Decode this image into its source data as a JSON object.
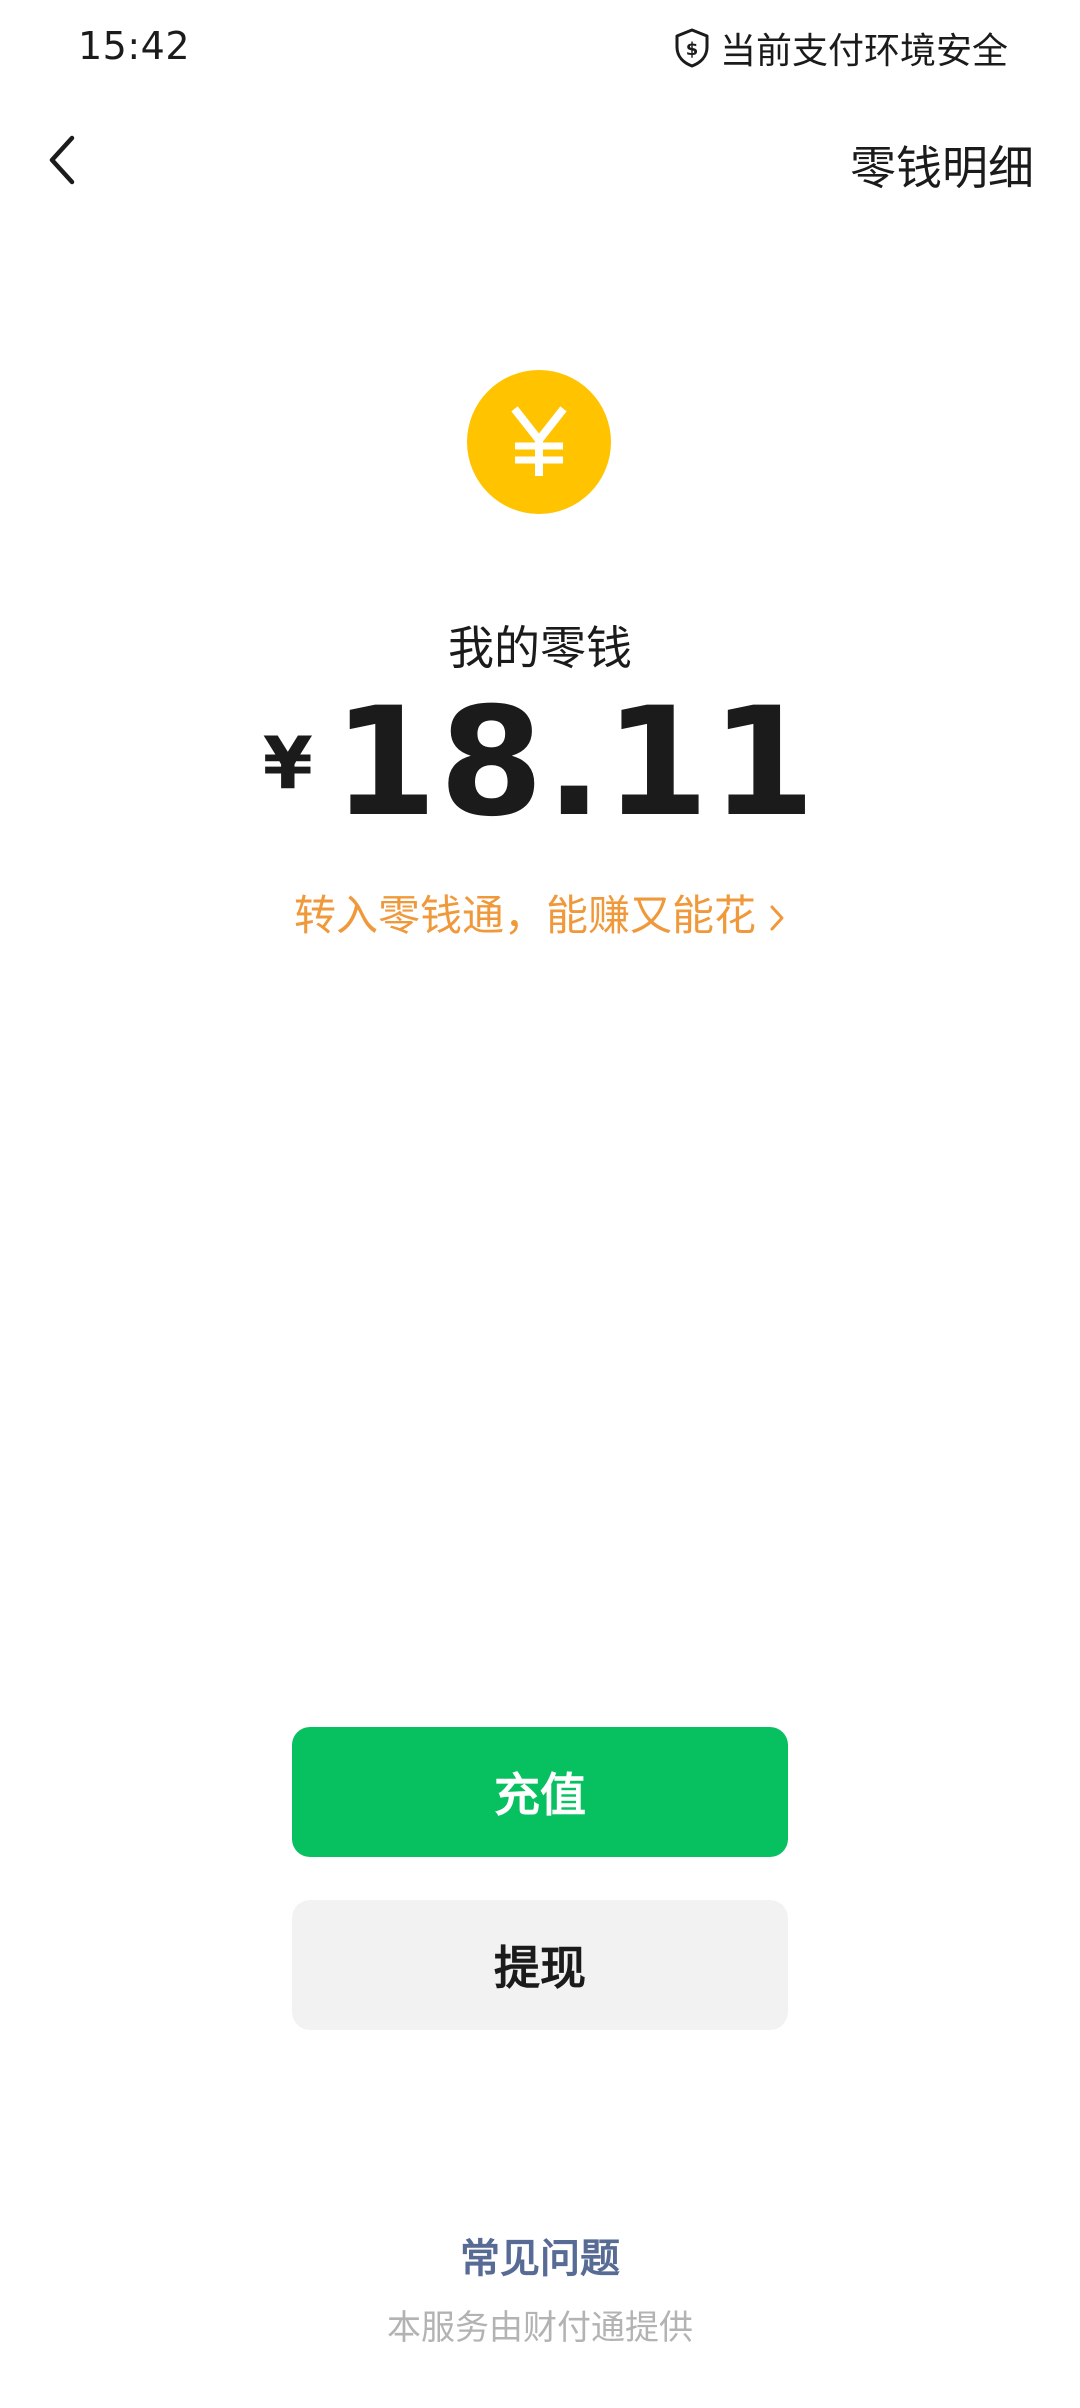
{
  "status_bar": {
    "time": "15:42",
    "security_text": "当前支付环境安全",
    "security_icon": "shield-dollar-icon"
  },
  "header": {
    "back_icon": "chevron-left-icon",
    "detail_link": "零钱明细"
  },
  "balance": {
    "coin_icon": "yuan-coin-icon",
    "coin_symbol": "¥",
    "label": "我的零钱",
    "currency_symbol": "¥",
    "amount": "18.11",
    "promo_text": "转入零钱通，能赚又能花",
    "promo_icon": "chevron-right-icon"
  },
  "actions": {
    "recharge_label": "充值",
    "withdraw_label": "提现"
  },
  "footer": {
    "faq_label": "常见问题",
    "provider_note": "本服务由财付通提供"
  },
  "colors": {
    "accent_green": "#07c160",
    "coin_yellow": "#ffc300",
    "promo_orange": "#f0993b",
    "link_blue": "#576b95",
    "secondary_button": "#f2f2f2"
  }
}
